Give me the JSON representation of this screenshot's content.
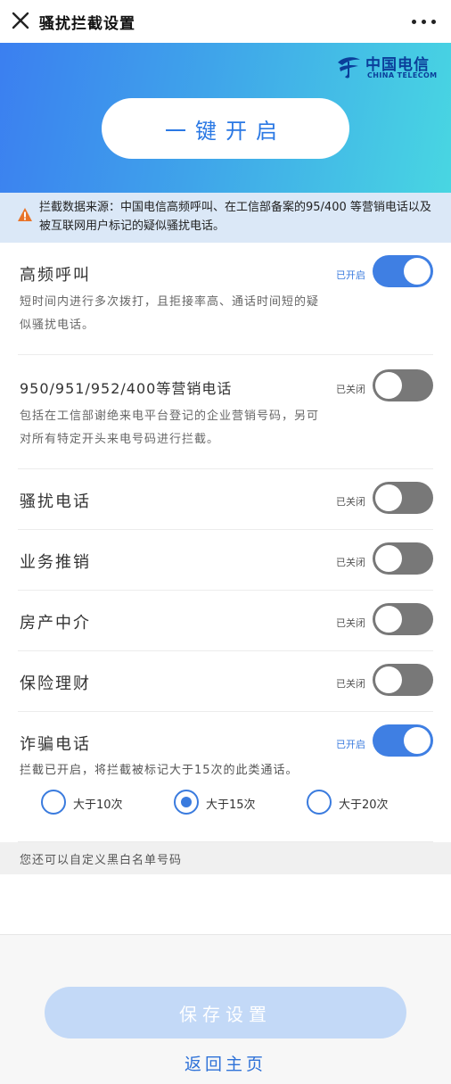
{
  "header": {
    "title": "骚扰拦截设置",
    "close_icon": "close-icon",
    "more_icon": "more-icon"
  },
  "hero": {
    "logo_cn": "中国电信",
    "logo_en": "CHINA TELECOM",
    "one_key_label": "一键开启"
  },
  "notice": {
    "text": "拦截数据来源：中国电信高频呼叫、在工信部备案的95/400 等营销电话以及被互联网用户标记的疑似骚扰电话。",
    "icon": "warning-icon"
  },
  "settings": [
    {
      "name": "高频呼叫",
      "desc": "短时间内进行多次拨打，且拒接率高、通话时间短的疑似骚扰电话。",
      "state": "已开启",
      "enabled": true
    },
    {
      "name": "950/951/952/400等营销电话",
      "desc": "包括在工信部谢绝来电平台登记的企业营销号码，另可对所有特定开头来电号码进行拦截。",
      "state": "已关闭",
      "enabled": false
    },
    {
      "name": "骚扰电话",
      "state": "已关闭",
      "enabled": false
    },
    {
      "name": "业务推销",
      "state": "已关闭",
      "enabled": false
    },
    {
      "name": "房产中介",
      "state": "已关闭",
      "enabled": false
    },
    {
      "name": "保险理财",
      "state": "已关闭",
      "enabled": false
    },
    {
      "name": "诈骗电话",
      "state": "已开启",
      "enabled": true
    }
  ],
  "fraud": {
    "desc": "拦截已开启，将拦截被标记大于15次的此类通话。",
    "options": [
      {
        "label": "大于10次",
        "selected": false
      },
      {
        "label": "大于15次",
        "selected": true
      },
      {
        "label": "大于20次",
        "selected": false
      }
    ]
  },
  "custom": {
    "label": "您还可以自定义黑白名单号码"
  },
  "footer": {
    "save_label": "保存设置",
    "home_label": "返回主页"
  },
  "colors": {
    "accent": "#3f7fe3",
    "toggle_off": "#787878",
    "save_disabled": "#c3d9f7",
    "notice_bg": "#dbe8f7"
  }
}
